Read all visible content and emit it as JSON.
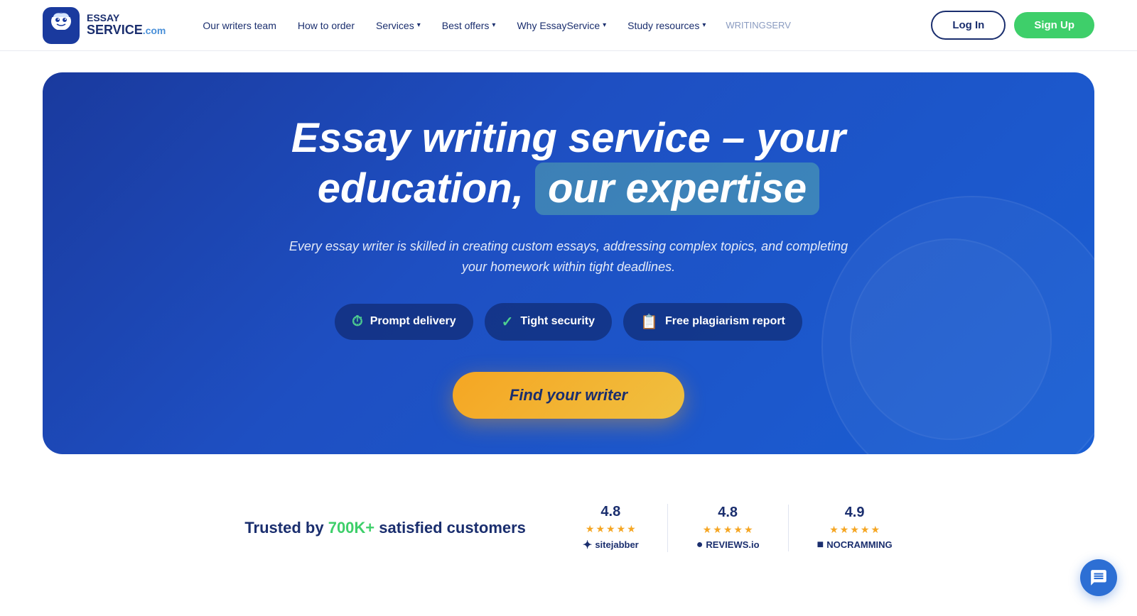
{
  "brand": {
    "name_line1": "ESSAY",
    "name_line2": "SERVICE",
    "dot": ".com"
  },
  "nav": {
    "items": [
      {
        "label": "Our writers team",
        "has_dropdown": false
      },
      {
        "label": "How to order",
        "has_dropdown": false
      },
      {
        "label": "Services",
        "has_dropdown": true
      },
      {
        "label": "Best offers",
        "has_dropdown": true
      },
      {
        "label": "Why EssayService",
        "has_dropdown": true
      },
      {
        "label": "Study resources",
        "has_dropdown": true
      }
    ],
    "partner": "WRITINGSERV",
    "login": "Log In",
    "signup": "Sign Up"
  },
  "hero": {
    "title_part1": "Essay writing service – your",
    "title_part2": "education,",
    "title_highlight": "our expertise",
    "subtitle": "Every essay writer is skilled in creating custom essays, addressing complex topics, and completing your homework within tight deadlines.",
    "badges": [
      {
        "icon": "⏱",
        "label": "Prompt delivery"
      },
      {
        "icon": "✓",
        "label": "Tight security"
      },
      {
        "icon": "📋",
        "label": "Free plagiarism report"
      }
    ],
    "cta": "Find your writer"
  },
  "trust": {
    "text_prefix": "Trusted by",
    "highlight": "700K+",
    "text_suffix": "satisfied customers",
    "reviews": [
      {
        "score": "4.8",
        "platform": "sitejabber",
        "icon": "✦"
      },
      {
        "score": "4.8",
        "platform": "REVIEWS.io",
        "icon": "●"
      },
      {
        "score": "4.9",
        "platform": "NOCRAMMING",
        "icon": "■"
      }
    ]
  }
}
